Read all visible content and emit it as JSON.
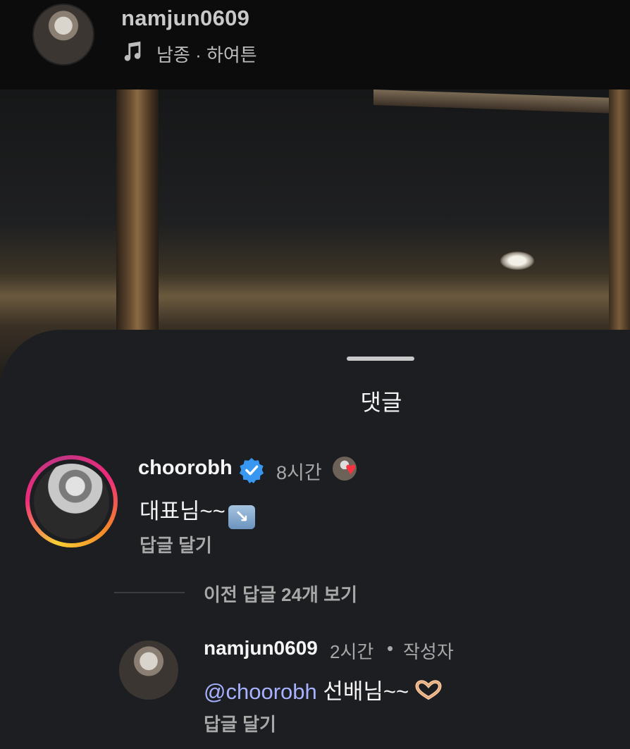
{
  "header": {
    "username": "namjun0609",
    "music_icon": "music-note-icon",
    "music_text": "남종 · 하여튼"
  },
  "sheet": {
    "title": "댓글"
  },
  "comments": [
    {
      "username": "choorobh",
      "verified_icon": "verified-badge-icon",
      "time": "8시간",
      "liked_by_creator_icon": "heart-icon",
      "text": "대표님~~",
      "emoji": "↘",
      "reply_label": "답글 달기"
    }
  ],
  "view_replies": "이전 답글 24개 보기",
  "reply": {
    "username": "namjun0609",
    "time": "2시간",
    "separator": "•",
    "author_label": "작성자",
    "mention": "@choorobh",
    "text": " 선배님~~",
    "emoji_icon": "heart-hands-icon",
    "reply_label": "답글 달기"
  },
  "colors": {
    "background": "#1c1e21",
    "mention": "#a6b2ff",
    "verified": "#3897f0",
    "heart": "#ff3040"
  }
}
